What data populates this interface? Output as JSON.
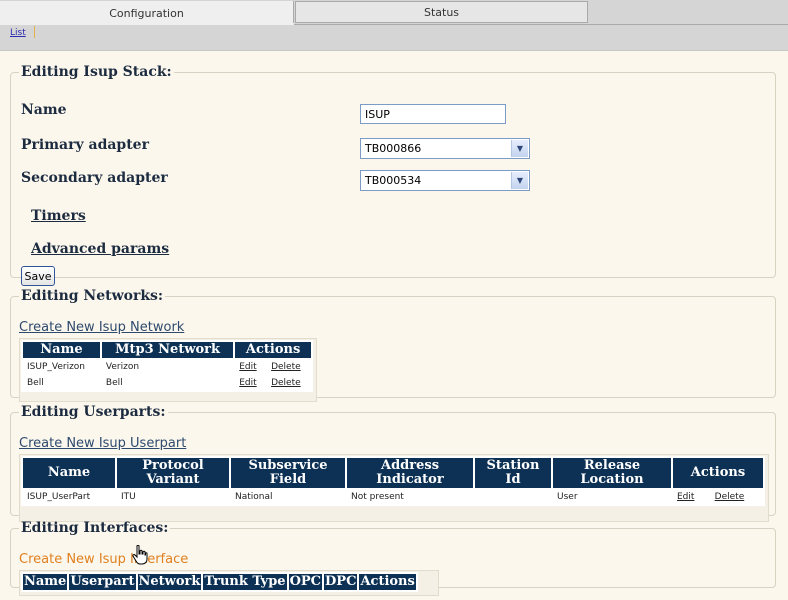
{
  "tabs": {
    "configuration": "Configuration",
    "status": "Status"
  },
  "breadcrumb": {
    "list": "List"
  },
  "stack": {
    "title": "Editing Isup Stack:",
    "name_label": "Name",
    "name_value": "ISUP",
    "primary_label": "Primary adapter",
    "primary_value": "TB000866",
    "secondary_label": "Secondary adapter",
    "secondary_value": "TB000534",
    "timers_link": "Timers",
    "advanced_link": "Advanced params",
    "save_label": "Save"
  },
  "networks": {
    "title": "Editing Networks:",
    "create_link": "Create New Isup Network",
    "headers": [
      "Name",
      "Mtp3 Network",
      "Actions"
    ],
    "rows": [
      {
        "name": "ISUP_Verizon",
        "mtp3": "Verizon",
        "edit": "Edit",
        "delete": "Delete"
      },
      {
        "name": "Bell",
        "mtp3": "Bell",
        "edit": "Edit",
        "delete": "Delete"
      }
    ]
  },
  "userparts": {
    "title": "Editing Userparts:",
    "create_link": "Create New Isup Userpart",
    "headers": [
      "Name",
      "Protocol Variant",
      "Subservice Field",
      "Address Indicator",
      "Station Id",
      "Release Location",
      "Actions"
    ],
    "rows": [
      {
        "name": "ISUP_UserPart",
        "protocol": "ITU",
        "subservice": "National",
        "address": "Not present",
        "station": "",
        "release": "User",
        "edit": "Edit",
        "delete": "Delete"
      }
    ]
  },
  "interfaces": {
    "title": "Editing Interfaces:",
    "create_link": "Create New Isup Interface",
    "headers": [
      "Name",
      "Userpart",
      "Network",
      "Trunk Type",
      "OPC",
      "DPC",
      "Actions"
    ]
  }
}
